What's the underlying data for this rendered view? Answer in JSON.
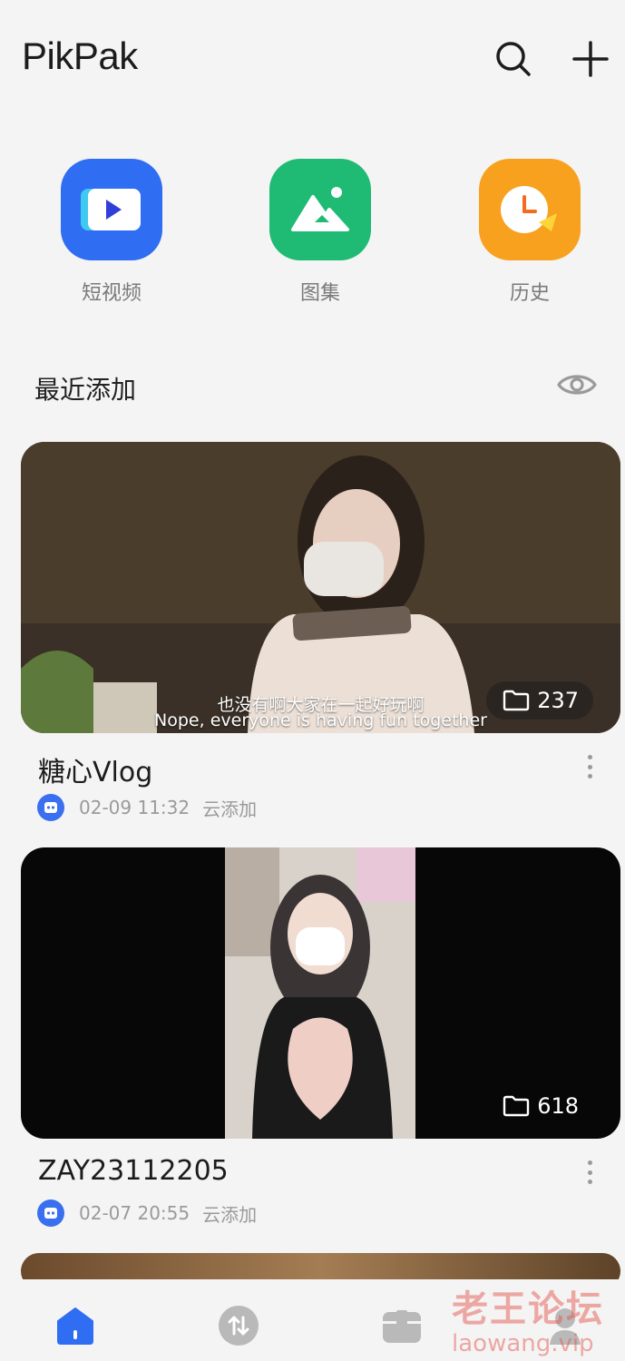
{
  "app": {
    "title": "PikPak"
  },
  "quick_access": [
    {
      "label": "短视频",
      "icon": "short-video-icon",
      "color": "#2f6df2"
    },
    {
      "label": "图集",
      "icon": "album-icon",
      "color": "#1fba74"
    },
    {
      "label": "历史",
      "icon": "history-clock-icon",
      "color": "#f7a11e"
    }
  ],
  "recent": {
    "title": "最近添加",
    "items": [
      {
        "title": "糖心Vlog",
        "count": "237",
        "date": "02-09 11:32",
        "source": "云添加",
        "subtitle_cn": "也没有啊大家在一起好玩啊",
        "subtitle_en": "Nope, everyone is having fun together"
      },
      {
        "title": "ZAY23112205",
        "count": "618",
        "date": "02-07 20:55",
        "source": "云添加"
      }
    ]
  },
  "tabs": [
    "home-icon",
    "transfer-icon",
    "box-icon",
    "me-icon"
  ],
  "watermark": {
    "line1": "老王论坛",
    "line2": "laowang.vip"
  },
  "colors": {
    "accent": "#2f6df2",
    "bg": "#f4f4f4"
  }
}
